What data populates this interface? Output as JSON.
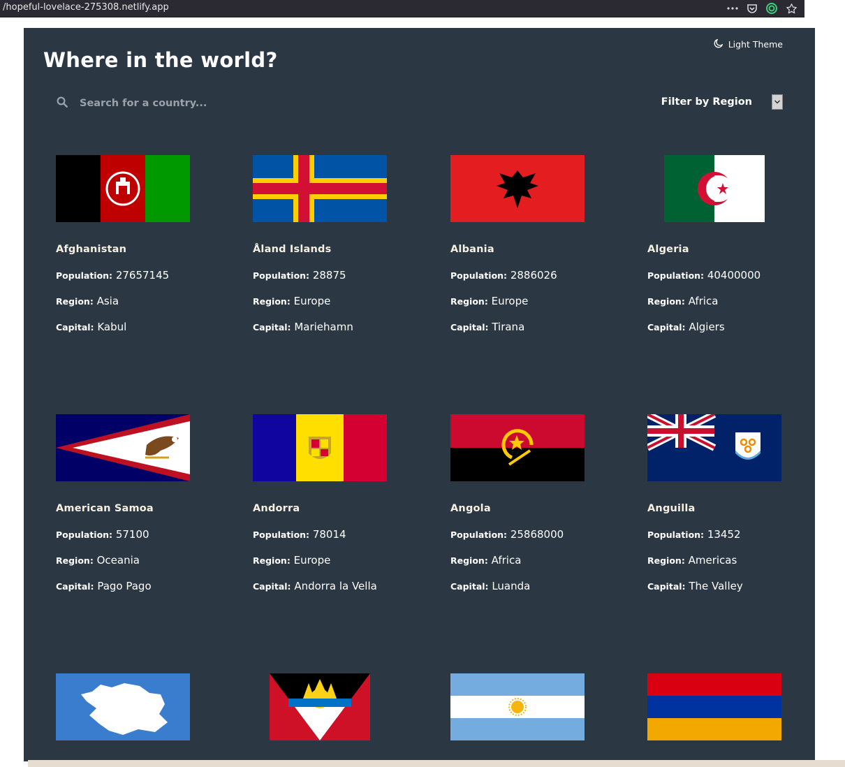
{
  "browser": {
    "url": "/hopeful-lovelace-275308.netlify.app",
    "icons": [
      "more-icon",
      "pocket-icon",
      "extension-icon",
      "bookmark-star-icon"
    ]
  },
  "header": {
    "title": "Where in the world?",
    "theme_toggle": "Light Theme"
  },
  "search": {
    "placeholder": "Search for a country..."
  },
  "filter": {
    "label": "Filter by Region"
  },
  "labels": {
    "population": "Population:",
    "region": "Region:",
    "capital": "Capital:"
  },
  "countries": [
    {
      "name": "Afghanistan",
      "population": "27657145",
      "region": "Asia",
      "capital": "Kabul",
      "flag": "afghanistan-flag"
    },
    {
      "name": "Åland Islands",
      "population": "28875",
      "region": "Europe",
      "capital": "Mariehamn",
      "flag": "aland-flag"
    },
    {
      "name": "Albania",
      "population": "2886026",
      "region": "Europe",
      "capital": "Tirana",
      "flag": "albania-flag"
    },
    {
      "name": "Algeria",
      "population": "40400000",
      "region": "Africa",
      "capital": "Algiers",
      "flag": "algeria-flag"
    },
    {
      "name": "American Samoa",
      "population": "57100",
      "region": "Oceania",
      "capital": "Pago Pago",
      "flag": "american-samoa-flag"
    },
    {
      "name": "Andorra",
      "population": "78014",
      "region": "Europe",
      "capital": "Andorra la Vella",
      "flag": "andorra-flag"
    },
    {
      "name": "Angola",
      "population": "25868000",
      "region": "Africa",
      "capital": "Luanda",
      "flag": "angola-flag"
    },
    {
      "name": "Anguilla",
      "population": "13452",
      "region": "Americas",
      "capital": "The Valley",
      "flag": "anguilla-flag"
    },
    {
      "flag": "antarctica-flag"
    },
    {
      "flag": "antigua-and-barbuda-flag"
    },
    {
      "flag": "argentina-flag"
    },
    {
      "flag": "armenia-flag"
    }
  ],
  "colors": {
    "background": "#2b3743",
    "text": "#ffffff",
    "country_name": "#f5f0e1",
    "placeholder": "#9aa1a9"
  }
}
